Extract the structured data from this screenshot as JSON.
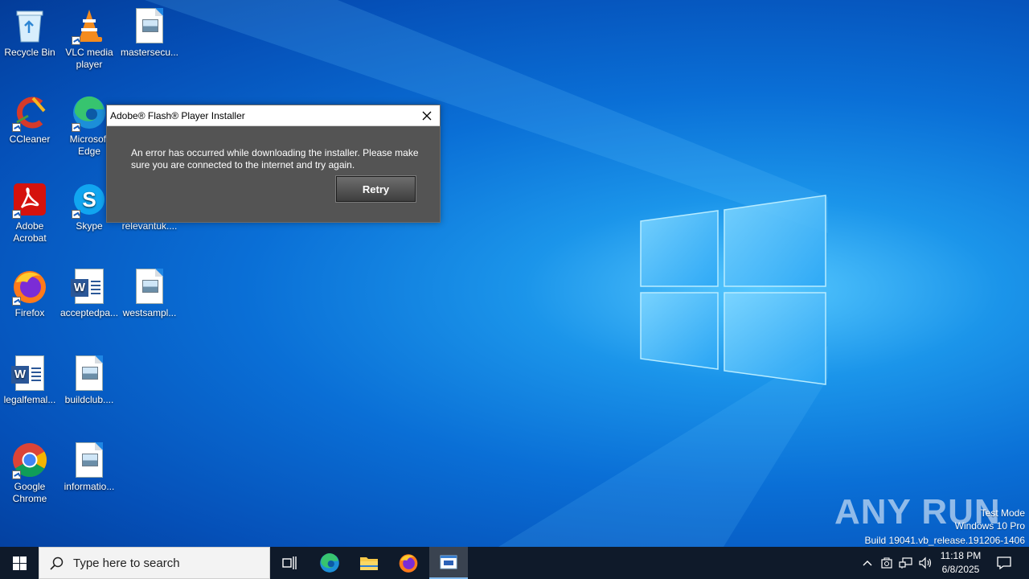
{
  "desktop": {
    "icons": [
      {
        "label": "Recycle Bin"
      },
      {
        "label": "VLC media player"
      },
      {
        "label": "mastersecu..."
      },
      {
        "label": "CCleaner"
      },
      {
        "label": "Microsoft Edge"
      },
      {
        "label": "Adobe Acrobat"
      },
      {
        "label": "Skype"
      },
      {
        "label": "relevantuk...."
      },
      {
        "label": "Firefox"
      },
      {
        "label": "acceptedpa..."
      },
      {
        "label": "westsampl..."
      },
      {
        "label": "legalfemal..."
      },
      {
        "label": "buildclub...."
      },
      {
        "label": "Google Chrome"
      },
      {
        "label": "informatio..."
      }
    ]
  },
  "dialog": {
    "title": "Adobe® Flash® Player Installer",
    "message": "An error has occurred while downloading the installer. Please make sure you are connected to the internet and try again.",
    "retry_label": "Retry"
  },
  "watermark": {
    "brand": "ANY RUN",
    "line1": "Test Mode",
    "line2": "Windows 10 Pro",
    "line3": "Build 19041.vb_release.191206-1406"
  },
  "taskbar": {
    "search_placeholder": "Type here to search",
    "time": "11:18 PM",
    "date": "6/8/2025"
  },
  "colors": {
    "wallpaper": "#0a6fd6",
    "taskbar": "#0f1a2a",
    "dialog_body": "#545454"
  }
}
